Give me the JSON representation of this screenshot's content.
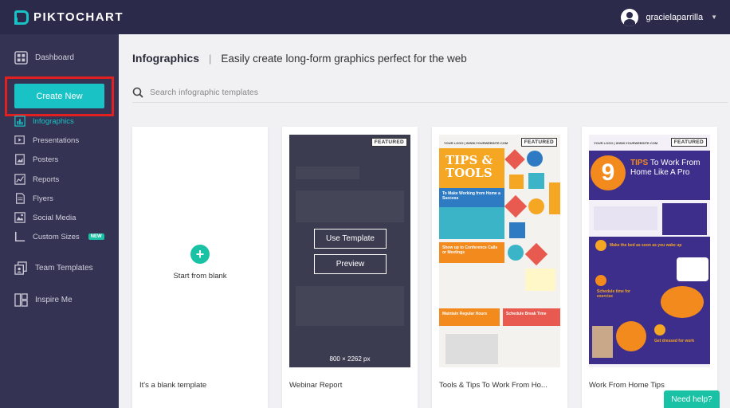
{
  "app": {
    "brand": "PIKTOCHART",
    "username": "gracielaparrilla"
  },
  "sidebar": {
    "dashboard": "Dashboard",
    "create_new": "Create New",
    "items": [
      {
        "label": "Infographics",
        "icon": "infographic-icon",
        "active": true
      },
      {
        "label": "Presentations",
        "icon": "presentation-icon"
      },
      {
        "label": "Posters",
        "icon": "poster-icon"
      },
      {
        "label": "Reports",
        "icon": "report-icon"
      },
      {
        "label": "Flyers",
        "icon": "flyer-icon"
      },
      {
        "label": "Social Media",
        "icon": "social-media-icon"
      },
      {
        "label": "Custom Sizes",
        "icon": "custom-size-icon",
        "badge": "NEW"
      }
    ],
    "team_templates": "Team Templates",
    "inspire_me": "Inspire Me"
  },
  "main": {
    "title": "Infographics",
    "separator": "|",
    "subtitle": "Easily create long-form graphics perfect for the web",
    "search_placeholder": "Search infographic templates"
  },
  "cards": [
    {
      "label": "It's a blank template",
      "center_text": "Start from blank"
    },
    {
      "label": "Webinar Report",
      "badge": "FEATURED",
      "use_template": "Use Template",
      "preview": "Preview",
      "size": "800 × 2262 px"
    },
    {
      "label": "Tools & Tips To Work From Ho...",
      "badge": "FEATURED",
      "thumb": {
        "header": "YOUR LOGO | WWW.YOURWEBSITE.COM",
        "title": "TIPS & TOOLS",
        "s1": "To Make Working from Home a Success",
        "s2": "Show up to Conference Calls or Meetings",
        "s3": "Maintain Regular Hours",
        "s4": "Schedule Break Time"
      }
    },
    {
      "label": "Work From Home Tips",
      "badge": "FEATURED",
      "thumb": {
        "header": "YOUR LOGO | WWW.YOURWEBSITE.COM",
        "number": "9",
        "title_accent": "TIPS",
        "title_rest": "To Work From Home Like A Pro",
        "step1": "Make the bed as soon as you wake up",
        "step2": "Schedule time for exercise",
        "step3": "Get dressed for work"
      }
    }
  ],
  "help": "Need help?",
  "colors": {
    "topbar": "#2c2a4a",
    "sidebar": "#353353",
    "accent": "#19c2c4",
    "highlight": "#e32020"
  }
}
